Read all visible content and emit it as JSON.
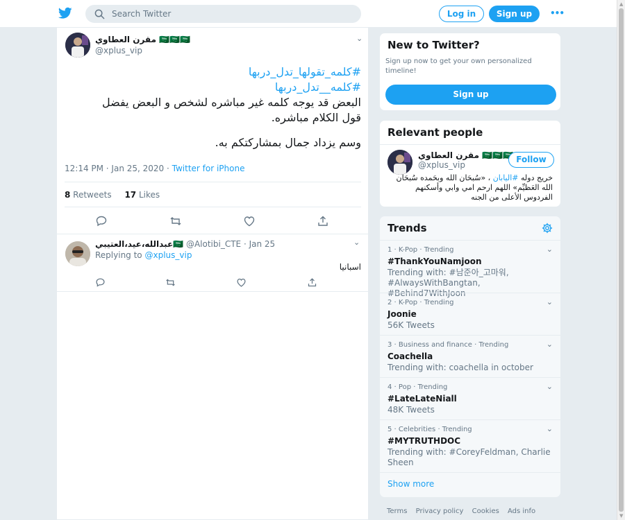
{
  "header": {
    "search_placeholder": "Search Twitter",
    "login_label": "Log in",
    "signup_label": "Sign up",
    "more_label": "•••"
  },
  "tweet": {
    "author_name": "مقرن العطاوي 🇸🇦🇸🇦🇸🇦",
    "author_handle": "@xplus_vip",
    "hashtag1": "#كلمه_تقولها_تدل_دربها",
    "hashtag2": "#كلمه__تدل_دربها",
    "line1": "البعض قد يوجه كلمه غير مباشره لشخص و البعض يفضل",
    "line2": "قول الكلام مباشره.",
    "line3": "وسم يزداد جمال بمشاركتكم به.",
    "time": "12:14 PM · Jan 25, 2020 · ",
    "via": "Twitter for iPhone",
    "retweets_count": "8",
    "retweets_label": " Retweets",
    "likes_count": "17",
    "likes_label": " Likes"
  },
  "reply": {
    "name": "عبدالله،عيد،العتيبي🇸🇦",
    "handle_date": " @Alotibi_CTE · Jan 25",
    "replying_label": "Replying to ",
    "replying_to": "@xplus_vip",
    "text": "اسبانيا"
  },
  "sidebar": {
    "new_title": "New to Twitter?",
    "new_text": "Sign up now to get your own personalized timeline!",
    "new_signup": "Sign up",
    "relevant_title": "Relevant people",
    "rel_name": "مقرن العطاوي 🇸🇦🇸🇦🇸🇦",
    "rel_handle": "@xplus_vip",
    "follow_label": "Follow",
    "rel_bio_pre": "خريج دوله ",
    "rel_bio_hash": "#اليابان",
    "rel_bio_post": " ، «سُبحَان الله وبحَمده سُبحَان الله العَظيِّم» اللهم ارحم امي وابي وأسكنهم الفردوس الأعلى من الجنه",
    "trends_title": "Trends",
    "trends": [
      {
        "ctx": "1 · K-Pop · Trending",
        "name": "#ThankYouNamjoon",
        "sub": "Trending with: #남준아_고마워, #AlwaysWithBangtan, #Behind7WithJoon"
      },
      {
        "ctx": "2 · K-Pop · Trending",
        "name": "Joonie",
        "sub": "56K Tweets"
      },
      {
        "ctx": "3 · Business and finance · Trending",
        "name": "Coachella",
        "sub": "Trending with: coachella in october"
      },
      {
        "ctx": "4 · Pop · Trending",
        "name": "#LateLateNiall",
        "sub": "48K Tweets"
      },
      {
        "ctx": "5 · Celebrities · Trending",
        "name": "#MYTRUTHDOC",
        "sub": "Trending with: #CoreyFeldman, Charlie Sheen"
      }
    ],
    "show_more": "Show more"
  },
  "footer": {
    "terms": "Terms",
    "privacy": "Privacy policy",
    "cookies": "Cookies",
    "ads": "Ads info"
  },
  "colors": {
    "accent": "#1da1f2",
    "background": "#e6ecf0",
    "muted_text": "#657786"
  }
}
